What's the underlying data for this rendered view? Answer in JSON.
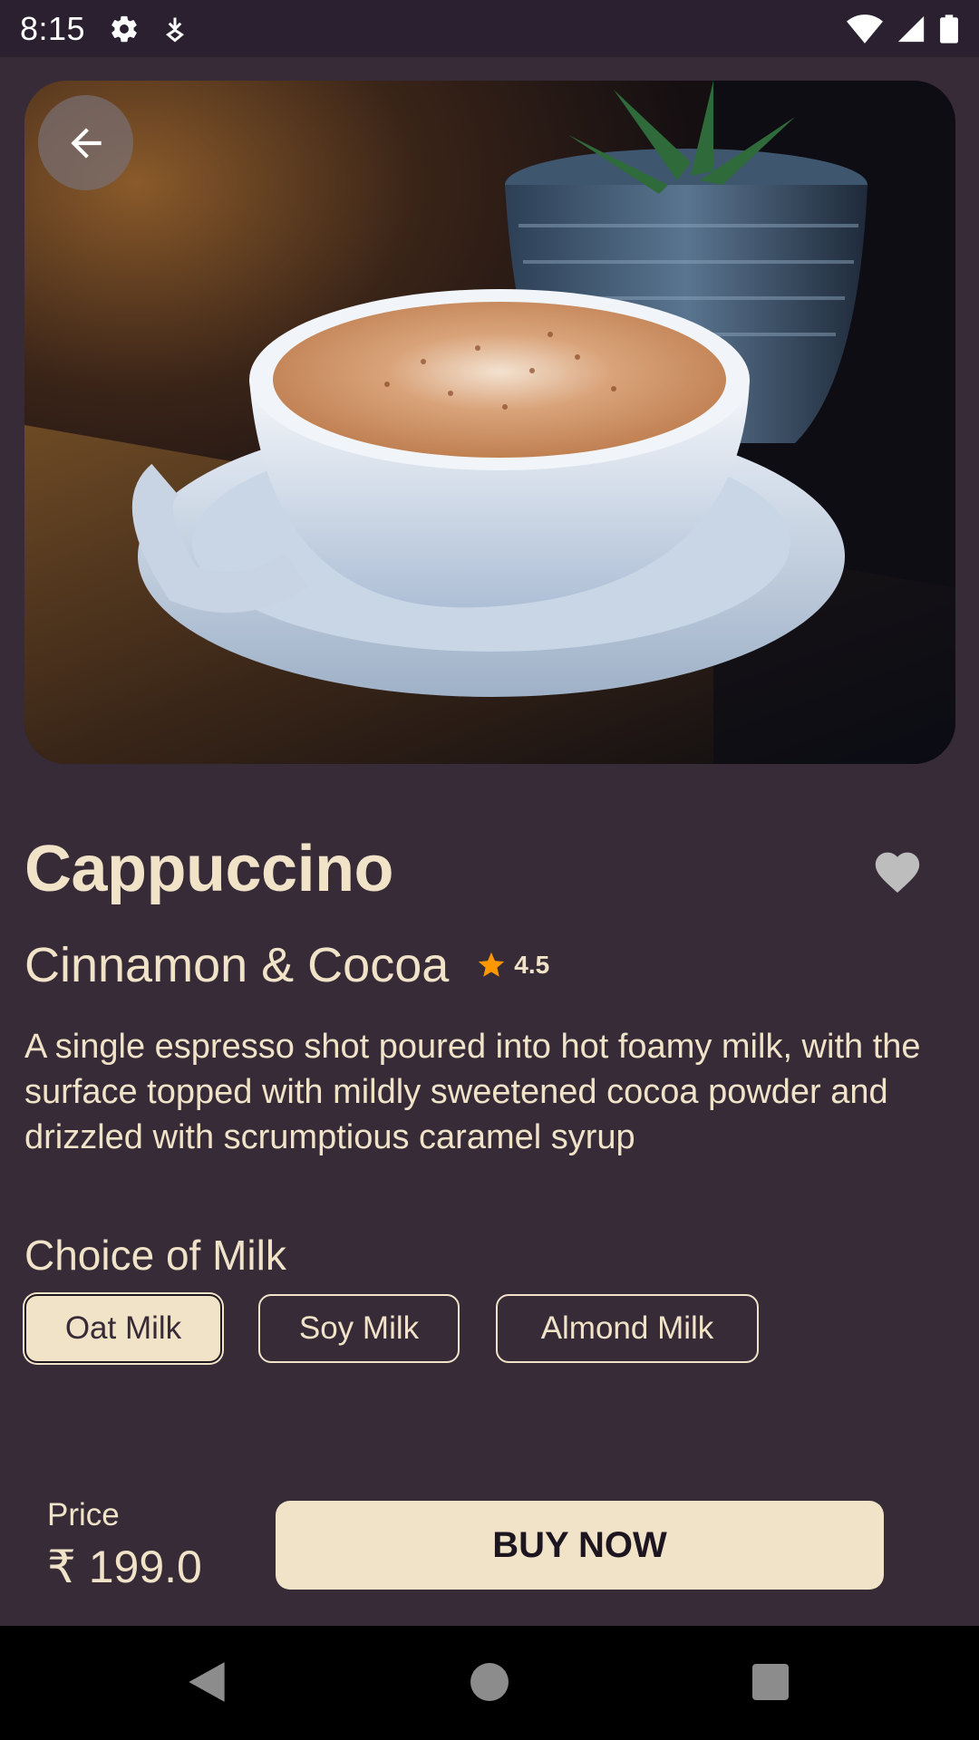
{
  "status_bar": {
    "time": "8:15",
    "icons": [
      "gear-icon",
      "download-icon",
      "wifi-icon",
      "signal-icon",
      "battery-icon"
    ]
  },
  "product": {
    "name": "Cappuccino",
    "subtitle": "Cinnamon & Cocoa",
    "rating": "4.5",
    "description": "A single espresso shot poured into hot foamy milk, with the surface topped with mildly sweetened cocoa powder and drizzled with scrumptious caramel syrup",
    "image_subject": "cup of cappuccino on saucer"
  },
  "milk": {
    "heading": "Choice of Milk",
    "options": [
      "Oat Milk",
      "Soy Milk",
      "Almond Milk"
    ],
    "selected": "Oat Milk"
  },
  "footer": {
    "price_label": "Price",
    "price_value": "₹ 199.0",
    "buy_label": "BUY NOW"
  },
  "colors": {
    "background": "#372b38",
    "accent": "#f1e3c8",
    "star": "#ff9800",
    "heart": "#bdbdbd"
  },
  "nav": {
    "icons": [
      "back-triangle-icon",
      "home-circle-icon",
      "recents-square-icon"
    ]
  }
}
